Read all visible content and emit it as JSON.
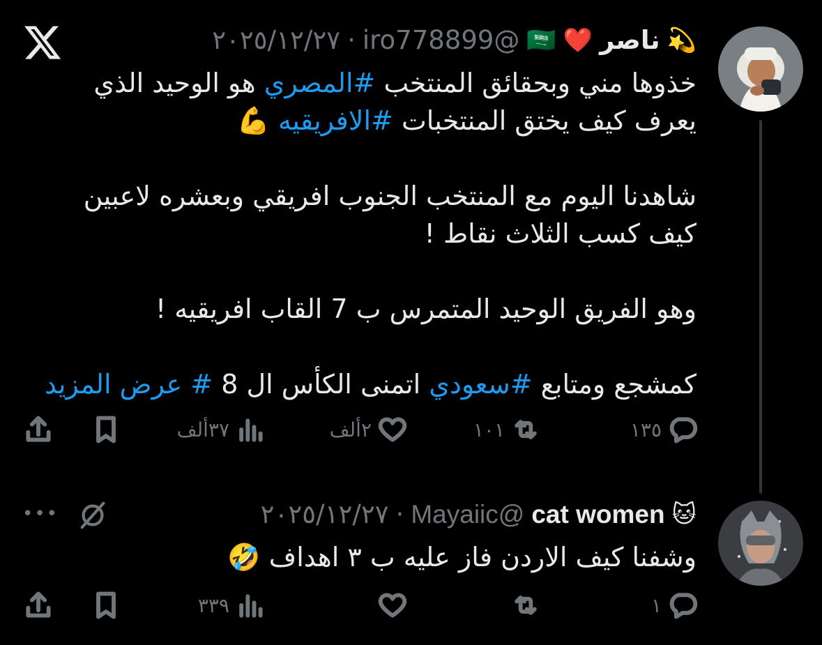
{
  "tweets": [
    {
      "name": "ناصر",
      "name_emoji_left": "❤️",
      "name_emoji_right": "💫",
      "flag_emoji": "🇸🇦",
      "handle": "@iro778899",
      "dot": "·",
      "date": "٢٠٢٥/١٢/٢٧",
      "paragraphs": [
        [
          {
            "t": "خذوها مني وبحقائق المنتخب "
          },
          {
            "t": "#المصري",
            "tag": true
          },
          {
            "t": " هو الوحيد الذي يعرف كيف يختق المنتخبات "
          },
          {
            "t": "#الافريقيه",
            "tag": true
          },
          {
            "t": " 💪"
          }
        ],
        [
          {
            "t": "شاهدنا اليوم مع المنتخب الجنوب افريقي وبعشره لاعبين كيف كسب الثلاث نقاط !"
          }
        ],
        [
          {
            "t": "وهو الفريق الوحيد المتمرس ب 7 القاب افريقيه !"
          }
        ],
        [
          {
            "t": "كمشجع ومتابع "
          },
          {
            "t": "#سعودي",
            "tag": true
          },
          {
            "t": " اتمنى الكأس ال 8 "
          },
          {
            "t": "#",
            "tag": true
          },
          {
            "t": " "
          },
          {
            "t": "عرض المزيد",
            "tag": true
          }
        ]
      ],
      "stats": {
        "replies": "١٣٥",
        "reposts": "١٠١",
        "likes": "٢ألف",
        "views": "٣٧ألف"
      }
    },
    {
      "name": "cat women",
      "name_emoji_right": "🐱",
      "handle": "@Mayaiic",
      "dot": "·",
      "date": "٢٠٢٥/١٢/٢٧",
      "paragraphs": [
        [
          {
            "t": "وشفنا كيف الاردن فاز عليه ب ٣ اهداف 🤣"
          }
        ]
      ],
      "stats": {
        "replies": "١",
        "reposts": "",
        "likes": "",
        "views": "٣٣٩"
      }
    }
  ],
  "more_label": "•••",
  "icons": {
    "x_logo": "x-logo-icon",
    "reply": "reply-icon",
    "repost": "repost-icon",
    "like": "heart-icon",
    "views": "views-icon",
    "bookmark": "bookmark-icon",
    "share": "share-icon",
    "grok": "grok-icon",
    "more": "more-icon"
  },
  "colors": {
    "background": "#000000",
    "text": "#e7e9ea",
    "muted": "#71767b",
    "link": "#1d9bf0",
    "line": "#333639"
  }
}
